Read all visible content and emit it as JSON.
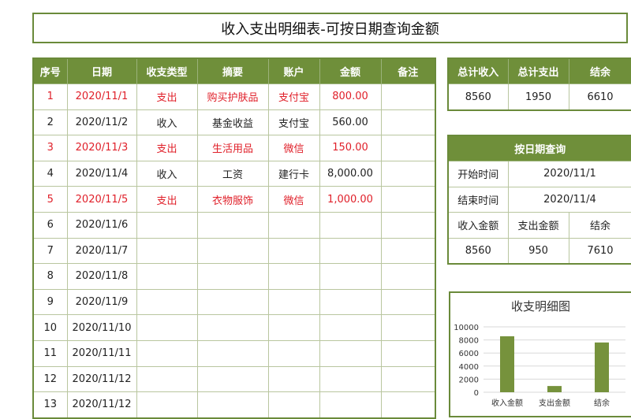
{
  "title": "收入支出明细表-可按日期查询金额",
  "main_table": {
    "headers": [
      "序号",
      "日期",
      "收支类型",
      "摘要",
      "账户",
      "金额",
      "备注"
    ],
    "rows": [
      {
        "no": "1",
        "date": "2020/11/1",
        "type": "支出",
        "summary": "购买护肤品",
        "account": "支付宝",
        "amount": "800.00",
        "note": "",
        "expense": true
      },
      {
        "no": "2",
        "date": "2020/11/2",
        "type": "收入",
        "summary": "基金收益",
        "account": "支付宝",
        "amount": "560.00",
        "note": "",
        "expense": false
      },
      {
        "no": "3",
        "date": "2020/11/3",
        "type": "支出",
        "summary": "生活用品",
        "account": "微信",
        "amount": "150.00",
        "note": "",
        "expense": true
      },
      {
        "no": "4",
        "date": "2020/11/4",
        "type": "收入",
        "summary": "工资",
        "account": "建行卡",
        "amount": "8,000.00",
        "note": "",
        "expense": false
      },
      {
        "no": "5",
        "date": "2020/11/5",
        "type": "支出",
        "summary": "衣物服饰",
        "account": "微信",
        "amount": "1,000.00",
        "note": "",
        "expense": true
      },
      {
        "no": "6",
        "date": "2020/11/6",
        "type": "",
        "summary": "",
        "account": "",
        "amount": "",
        "note": "",
        "expense": false
      },
      {
        "no": "7",
        "date": "2020/11/7",
        "type": "",
        "summary": "",
        "account": "",
        "amount": "",
        "note": "",
        "expense": false
      },
      {
        "no": "8",
        "date": "2020/11/8",
        "type": "",
        "summary": "",
        "account": "",
        "amount": "",
        "note": "",
        "expense": false
      },
      {
        "no": "9",
        "date": "2020/11/9",
        "type": "",
        "summary": "",
        "account": "",
        "amount": "",
        "note": "",
        "expense": false
      },
      {
        "no": "10",
        "date": "2020/11/10",
        "type": "",
        "summary": "",
        "account": "",
        "amount": "",
        "note": "",
        "expense": false
      },
      {
        "no": "11",
        "date": "2020/11/11",
        "type": "",
        "summary": "",
        "account": "",
        "amount": "",
        "note": "",
        "expense": false
      },
      {
        "no": "12",
        "date": "2020/11/12",
        "type": "",
        "summary": "",
        "account": "",
        "amount": "",
        "note": "",
        "expense": false
      },
      {
        "no": "13",
        "date": "2020/11/12",
        "type": "",
        "summary": "",
        "account": "",
        "amount": "",
        "note": "",
        "expense": false
      }
    ]
  },
  "totals": {
    "headers": [
      "总计收入",
      "总计支出",
      "结余"
    ],
    "values": [
      "8560",
      "1950",
      "6610"
    ]
  },
  "query": {
    "title": "按日期查询",
    "start_label": "开始时间",
    "start_value": "2020/11/1",
    "end_label": "结束时间",
    "end_value": "2020/11/4",
    "result_headers": [
      "收入金额",
      "支出金额",
      "结余"
    ],
    "result_values": [
      "8560",
      "950",
      "7610"
    ]
  },
  "colors": {
    "header_green": "#6f8f3a",
    "bar_green": "#76923c",
    "expense_red": "#e0202a"
  },
  "chart_data": {
    "type": "bar",
    "title": "收支明细图",
    "categories": [
      "收入金额",
      "支出金额",
      "结余"
    ],
    "values": [
      8560,
      950,
      7610
    ],
    "yticks": [
      "10000",
      "8000",
      "6000",
      "4000",
      "2000",
      "0"
    ],
    "ylim": [
      0,
      10000
    ],
    "grid": true,
    "legend": "none"
  }
}
